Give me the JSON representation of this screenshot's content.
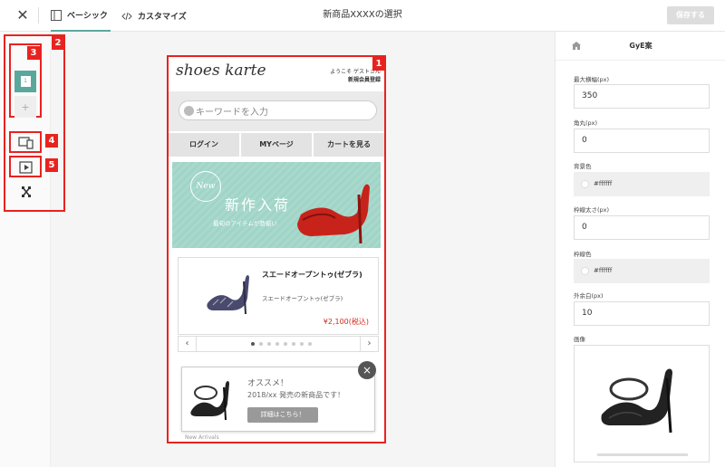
{
  "topbar": {
    "close_icon": "close-icon",
    "tabs": [
      {
        "label": "ベーシック",
        "icon": "layout-icon",
        "active": true
      },
      {
        "label": "カスタマイズ",
        "icon": "code-icon",
        "active": false
      }
    ],
    "title": "新商品XXXXの選択",
    "save_label": "保存する"
  },
  "annotations": {
    "callouts": [
      "1",
      "2",
      "3",
      "4",
      "5"
    ],
    "color": "#e8231f"
  },
  "tools": {
    "slide_thumb_label": "1",
    "add_icon": "plus-icon",
    "responsive_icon": "devices-icon",
    "preview_icon": "play-icon",
    "fullscreen_icon": "expand-icon"
  },
  "preview": {
    "logo": "shoes karte",
    "welcome": "ようこそ ゲストさん",
    "register": "新規会員登録",
    "search_placeholder": "キーワードを入力",
    "nav": [
      "ログイン",
      "MYページ",
      "カートを見る"
    ],
    "banner": {
      "badge": "New",
      "title": "新作入荷",
      "subtitle": "最旬のアイテムが勢揃い"
    },
    "product": {
      "name": "スエードオープントゥ(ゼブラ)",
      "sub": "スエードオープントゥ(ゼブラ)",
      "price": "¥2,100(税込)"
    },
    "pager": {
      "prev": "‹",
      "next": "›",
      "dot_count": 8,
      "active": 1
    },
    "popup": {
      "title": "オススメ！",
      "text": "2018/xx 発売の新商品です！",
      "button": "詳細はこちら！",
      "close": "×"
    },
    "cut_text": "New Arrivals"
  },
  "panel": {
    "title": "GyE案",
    "fields": [
      {
        "label": "最大横幅(px)",
        "value": "350",
        "type": "text"
      },
      {
        "label": "角丸(px)",
        "value": "0",
        "type": "text"
      },
      {
        "label": "背景色",
        "value": "#ffffff",
        "type": "color"
      },
      {
        "label": "枠線太さ(px)",
        "value": "0",
        "type": "text"
      },
      {
        "label": "枠線色",
        "value": "#ffffff",
        "type": "color"
      },
      {
        "label": "外余白(px)",
        "value": "10",
        "type": "text"
      }
    ],
    "image_label": "画像"
  },
  "colors": {
    "accent": "#5aa89c",
    "banner": "#a9d9cc",
    "price": "#d12a1e"
  }
}
